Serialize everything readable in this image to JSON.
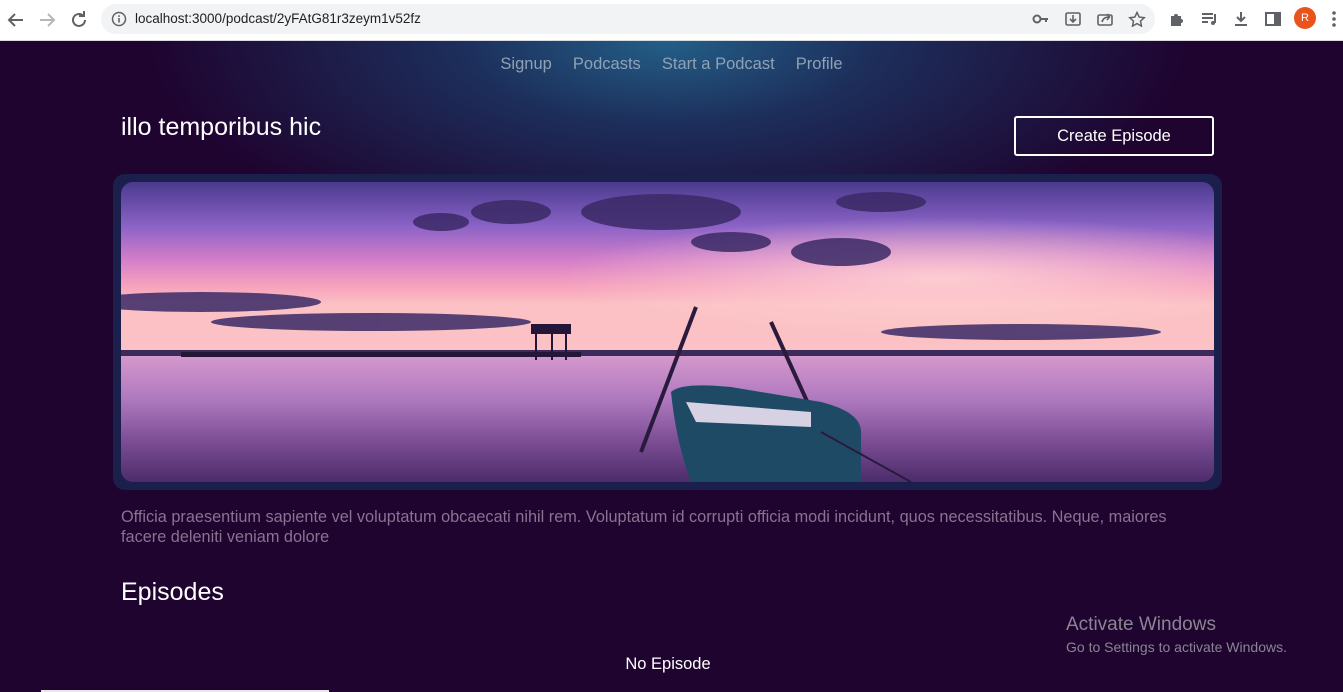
{
  "browser": {
    "url": "localhost:3000/podcast/2yFAtG81r3zeym1v52fz",
    "profile_initial": "R",
    "icons": [
      "back-arrow-icon",
      "forward-arrow-icon",
      "reload-icon",
      "site-info-icon",
      "key-icon",
      "install-app-icon",
      "share-icon",
      "bookmark-star-icon",
      "extensions-puzzle-icon",
      "media-playlist-icon",
      "download-icon",
      "side-panel-icon",
      "kebab-menu-icon"
    ]
  },
  "nav": {
    "items": [
      "Signup",
      "Podcasts",
      "Start a Podcast",
      "Profile"
    ]
  },
  "podcast": {
    "title": "illo temporibus hic",
    "create_button": "Create Episode",
    "description": "Officia praesentium sapiente vel voluptatum obcaecati nihil rem. Voluptatum id corrupti officia modi incidunt, quos necessitatibus. Neque, maiores facere deleniti veniam dolore"
  },
  "episodes": {
    "heading": "Episodes",
    "empty_text": "No Episode"
  },
  "watermark": {
    "line1": "Activate Windows",
    "line2": "Go to Settings to activate Windows."
  },
  "colors": {
    "page_bg": "#1f0430",
    "nav_link": "#8fa2b5",
    "description_text": "#8a7290",
    "banner_frame": "#1b1f4c"
  }
}
